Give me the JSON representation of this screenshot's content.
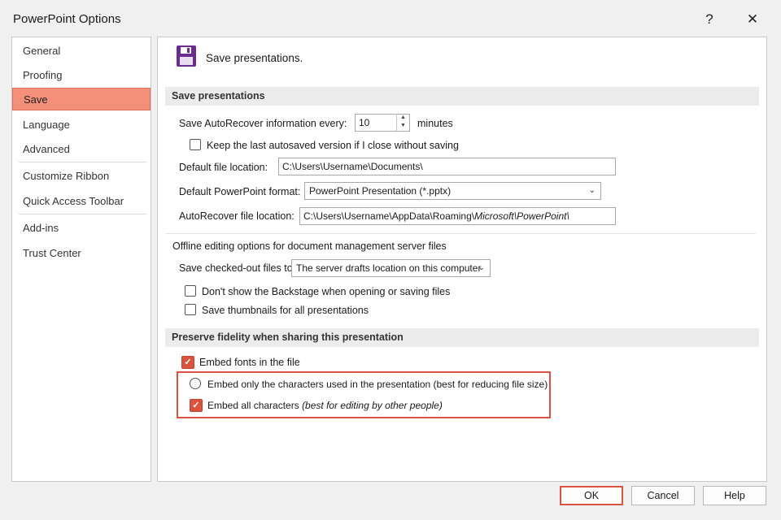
{
  "window": {
    "title": "PowerPoint Options",
    "help_glyph": "?",
    "close_glyph": "✕"
  },
  "nav": {
    "items": [
      {
        "label": "General"
      },
      {
        "label": "Proofing"
      },
      {
        "label": "Save"
      },
      {
        "label": "Language"
      },
      {
        "label": "Advanced"
      },
      {
        "label": "Customize Ribbon"
      },
      {
        "label": "Quick Access Toolbar"
      },
      {
        "label": "Add-ins"
      },
      {
        "label": "Trust Center"
      }
    ],
    "selected": "Save"
  },
  "page": {
    "heading": "Save presentations."
  },
  "save_section": {
    "header": "Save presentations",
    "autorecover_label": "Save AutoRecover information every:",
    "autorecover_value": "10",
    "minutes_label": "minutes",
    "keep_last_label": "Keep the last autosaved version if I close without saving",
    "default_location_label": "Default file location:",
    "default_location_value": "C:\\Users\\Username\\Documents\\",
    "default_format_label": "Default PowerPoint format:",
    "default_format_value": "PowerPoint Presentation (*.pptx)",
    "autorecover_location_label": "AutoRecover file location:",
    "autorecover_location_value_prefix": "C:\\Users\\Username\\AppData\\Roaming\\",
    "autorecover_location_value_italic": "Microsoft\\PowerPoint\\"
  },
  "offline_section": {
    "title": "Offline editing options for document management server files",
    "checked_out_label": "Save checked-out files to:",
    "checked_out_value": "The server drafts location on this computer",
    "backstage_label": "Don't show the Backstage when opening or saving files",
    "thumbnails_label": "Save thumbnails for all presentations"
  },
  "fidelity_section": {
    "header": "Preserve fidelity when sharing this presentation",
    "embed_fonts_label": "Embed fonts in the file",
    "embed_used_label": "Embed only the characters used in the presentation (best for reducing file size)",
    "embed_all_label": "Embed all characters",
    "embed_all_hint": "(best for editing by other people)"
  },
  "footer": {
    "ok": "OK",
    "cancel": "Cancel",
    "help": "Help"
  },
  "colors": {
    "accent": "#d9533f",
    "nav_selected": "#f4907a",
    "save_icon": "#6a2c8e"
  }
}
